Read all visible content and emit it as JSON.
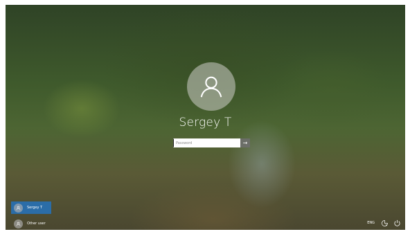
{
  "user": {
    "name": "Sergey T"
  },
  "password": {
    "placeholder": "Password",
    "value": ""
  },
  "user_list": [
    {
      "name": "Sergey T",
      "selected": true
    },
    {
      "name": "Other user",
      "selected": false
    }
  ],
  "tray": {
    "language": "ENG"
  },
  "icons": {
    "avatar": "person-icon",
    "submit": "arrow-right-icon",
    "accessibility": "ease-of-access-icon",
    "power": "power-icon"
  },
  "colors": {
    "selected_tile": "#2b6da8"
  }
}
